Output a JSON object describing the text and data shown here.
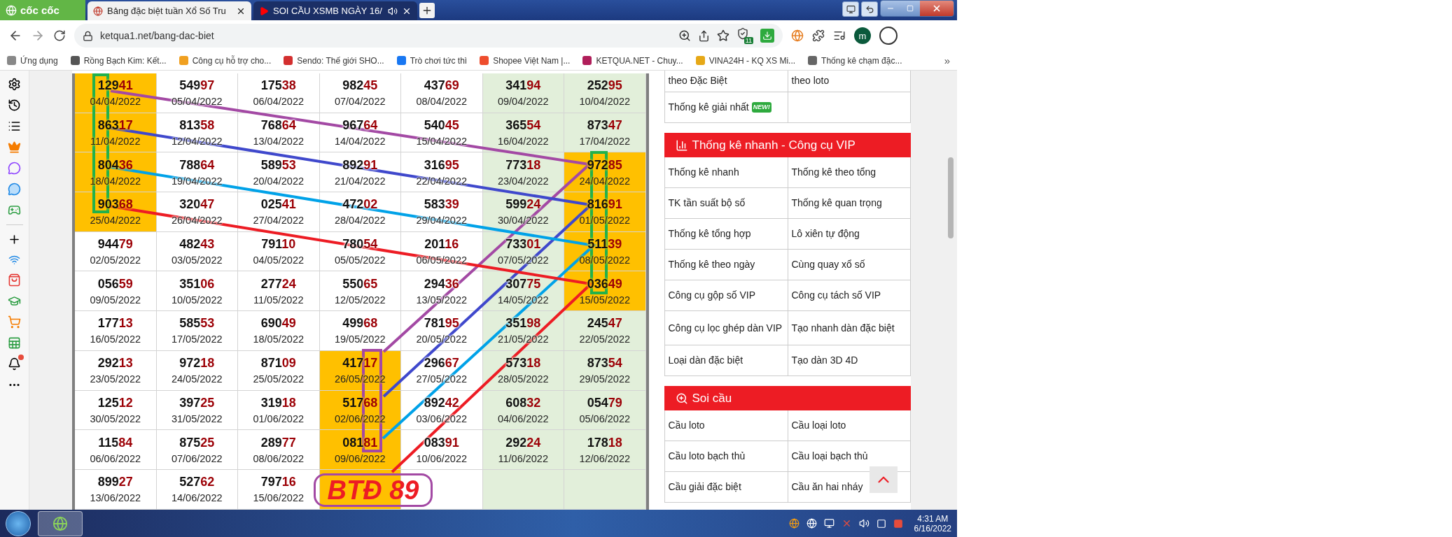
{
  "browser": {
    "logo": "cốc cốc",
    "tabs": [
      {
        "title": "Bảng đặc biệt tuần Xổ Số Tru",
        "selected": true,
        "kind": "site"
      },
      {
        "title": "SOI CẦU XSMB NGÀY 16/",
        "selected": false,
        "kind": "video"
      }
    ],
    "address": "ketqua1.net/bang-dac-biet",
    "extension_badge": "11",
    "profile_initial": "m",
    "bookmarks": [
      {
        "label": "Ứng dụng"
      },
      {
        "label": "Rồng Bạch Kim: Kết..."
      },
      {
        "label": "Công cụ hỗ trợ cho..."
      },
      {
        "label": "Sendo: Thế giới SHO..."
      },
      {
        "label": "Trò chơi tức thì"
      },
      {
        "label": "Shopee Việt Nam |..."
      },
      {
        "label": "KETQUA.NET - Chuy..."
      },
      {
        "label": "VINA24H - KQ XS Mi..."
      },
      {
        "label": "Thống kê chạm đặc..."
      }
    ],
    "more": "»"
  },
  "table": {
    "columns": [
      {
        "shaded": false
      },
      {
        "shaded": false
      },
      {
        "shaded": false
      },
      {
        "shaded": false
      },
      {
        "shaded": false
      },
      {
        "shaded": true
      },
      {
        "shaded": true
      }
    ],
    "rows": [
      [
        {
          "number": "12941",
          "date": "04/04/2022",
          "highlighted": true
        },
        {
          "number": "54997",
          "date": "05/04/2022",
          "highlighted": false
        },
        {
          "number": "17538",
          "date": "06/04/2022",
          "highlighted": false
        },
        {
          "number": "98245",
          "date": "07/04/2022",
          "highlighted": false
        },
        {
          "number": "43769",
          "date": "08/04/2022",
          "highlighted": false
        },
        {
          "number": "34194",
          "date": "09/04/2022",
          "highlighted": false
        },
        {
          "number": "25295",
          "date": "10/04/2022",
          "highlighted": false
        }
      ],
      [
        {
          "number": "86317",
          "date": "11/04/2022",
          "highlighted": true
        },
        {
          "number": "81358",
          "date": "12/04/2022",
          "highlighted": false
        },
        {
          "number": "76864",
          "date": "13/04/2022",
          "highlighted": false
        },
        {
          "number": "96764",
          "date": "14/04/2022",
          "highlighted": false
        },
        {
          "number": "54045",
          "date": "15/04/2022",
          "highlighted": false
        },
        {
          "number": "36554",
          "date": "16/04/2022",
          "highlighted": false
        },
        {
          "number": "87347",
          "date": "17/04/2022",
          "highlighted": false
        }
      ],
      [
        {
          "number": "80436",
          "date": "18/04/2022",
          "highlighted": true
        },
        {
          "number": "78864",
          "date": "19/04/2022",
          "highlighted": false
        },
        {
          "number": "58953",
          "date": "20/04/2022",
          "highlighted": false
        },
        {
          "number": "89291",
          "date": "21/04/2022",
          "highlighted": false
        },
        {
          "number": "31695",
          "date": "22/04/2022",
          "highlighted": false
        },
        {
          "number": "77318",
          "date": "23/04/2022",
          "highlighted": false
        },
        {
          "number": "97285",
          "date": "24/04/2022",
          "highlighted": true
        }
      ],
      [
        {
          "number": "90368",
          "date": "25/04/2022",
          "highlighted": true
        },
        {
          "number": "32047",
          "date": "26/04/2022",
          "highlighted": false
        },
        {
          "number": "02541",
          "date": "27/04/2022",
          "highlighted": false
        },
        {
          "number": "47202",
          "date": "28/04/2022",
          "highlighted": false
        },
        {
          "number": "58339",
          "date": "29/04/2022",
          "highlighted": false
        },
        {
          "number": "59924",
          "date": "30/04/2022",
          "highlighted": false
        },
        {
          "number": "81691",
          "date": "01/05/2022",
          "highlighted": true
        }
      ],
      [
        {
          "number": "94479",
          "date": "02/05/2022",
          "highlighted": false
        },
        {
          "number": "48243",
          "date": "03/05/2022",
          "highlighted": false
        },
        {
          "number": "79110",
          "date": "04/05/2022",
          "highlighted": false
        },
        {
          "number": "78054",
          "date": "05/05/2022",
          "highlighted": false
        },
        {
          "number": "20116",
          "date": "06/05/2022",
          "highlighted": false
        },
        {
          "number": "73301",
          "date": "07/05/2022",
          "highlighted": false
        },
        {
          "number": "51139",
          "date": "08/05/2022",
          "highlighted": true
        }
      ],
      [
        {
          "number": "05659",
          "date": "09/05/2022",
          "highlighted": false
        },
        {
          "number": "35106",
          "date": "10/05/2022",
          "highlighted": false
        },
        {
          "number": "27724",
          "date": "11/05/2022",
          "highlighted": false
        },
        {
          "number": "55065",
          "date": "12/05/2022",
          "highlighted": false
        },
        {
          "number": "29436",
          "date": "13/05/2022",
          "highlighted": false
        },
        {
          "number": "30775",
          "date": "14/05/2022",
          "highlighted": false
        },
        {
          "number": "03649",
          "date": "15/05/2022",
          "highlighted": true
        }
      ],
      [
        {
          "number": "17713",
          "date": "16/05/2022",
          "highlighted": false
        },
        {
          "number": "58553",
          "date": "17/05/2022",
          "highlighted": false
        },
        {
          "number": "69049",
          "date": "18/05/2022",
          "highlighted": false
        },
        {
          "number": "49968",
          "date": "19/05/2022",
          "highlighted": false
        },
        {
          "number": "78195",
          "date": "20/05/2022",
          "highlighted": false
        },
        {
          "number": "35198",
          "date": "21/05/2022",
          "highlighted": false
        },
        {
          "number": "24547",
          "date": "22/05/2022",
          "highlighted": false
        }
      ],
      [
        {
          "number": "29213",
          "date": "23/05/2022",
          "highlighted": false
        },
        {
          "number": "97218",
          "date": "24/05/2022",
          "highlighted": false
        },
        {
          "number": "87109",
          "date": "25/05/2022",
          "highlighted": false
        },
        {
          "number": "41717",
          "date": "26/05/2022",
          "highlighted": true
        },
        {
          "number": "29667",
          "date": "27/05/2022",
          "highlighted": false
        },
        {
          "number": "57318",
          "date": "28/05/2022",
          "highlighted": false
        },
        {
          "number": "87354",
          "date": "29/05/2022",
          "highlighted": false
        }
      ],
      [
        {
          "number": "12512",
          "date": "30/05/2022",
          "highlighted": false
        },
        {
          "number": "39725",
          "date": "31/05/2022",
          "highlighted": false
        },
        {
          "number": "31918",
          "date": "01/06/2022",
          "highlighted": false
        },
        {
          "number": "51768",
          "date": "02/06/2022",
          "highlighted": true
        },
        {
          "number": "89242",
          "date": "03/06/2022",
          "highlighted": false
        },
        {
          "number": "60832",
          "date": "04/06/2022",
          "highlighted": false
        },
        {
          "number": "05479",
          "date": "05/06/2022",
          "highlighted": false
        }
      ],
      [
        {
          "number": "11584",
          "date": "06/06/2022",
          "highlighted": false
        },
        {
          "number": "87525",
          "date": "07/06/2022",
          "highlighted": false
        },
        {
          "number": "28977",
          "date": "08/06/2022",
          "highlighted": false
        },
        {
          "number": "08181",
          "date": "09/06/2022",
          "highlighted": true
        },
        {
          "number": "08391",
          "date": "10/06/2022",
          "highlighted": false
        },
        {
          "number": "29224",
          "date": "11/06/2022",
          "highlighted": false
        },
        {
          "number": "17818",
          "date": "12/06/2022",
          "highlighted": false
        }
      ],
      [
        {
          "number": "89927",
          "date": "13/06/2022",
          "highlighted": false
        },
        {
          "number": "52762",
          "date": "14/06/2022",
          "highlighted": false
        },
        {
          "number": "79716",
          "date": "15/06/2022",
          "highlighted": false
        },
        {
          "highlighted": true
        },
        {
          "highlighted": false
        },
        {
          "highlighted": false
        },
        {
          "highlighted": false
        }
      ]
    ]
  },
  "annotation": {
    "label": "BTĐ 89",
    "frames": [
      {
        "color": "#22b14c"
      },
      {
        "color": "#22b14c"
      },
      {
        "color": "#a349a4"
      }
    ],
    "lines": [
      {
        "color": "#a349a4"
      },
      {
        "color": "#3f48cc"
      },
      {
        "color": "#00a2e8"
      },
      {
        "color": "#ed1c24"
      }
    ]
  },
  "sidebar": {
    "top_rows": [
      {
        "cells": [
          {
            "text": "theo Đặc Biệt"
          },
          {
            "text": "theo loto"
          }
        ]
      },
      {
        "cells": [
          {
            "text": "Thống kê giải nhất",
            "badge": "NEW!"
          }
        ]
      }
    ],
    "sections": [
      {
        "title": "Thống kê nhanh - Công cụ VIP",
        "kind": "chart",
        "rows": [
          [
            "Thống kê nhanh",
            "Thống kê theo tổng"
          ],
          [
            "TK tần suất bộ số",
            "Thống kê quan trọng"
          ],
          [
            "Thống kê tổng hợp",
            "Lô xiên tự động"
          ],
          [
            "Thống kê theo ngày",
            "Cùng quay xổ số"
          ],
          [
            "Công cụ gộp số VIP",
            "Công cụ tách số VIP"
          ],
          [
            "Công cụ lọc ghép dàn VIP",
            "Tạo nhanh dàn đặc biệt"
          ],
          [
            "Loại dàn đặc biệt",
            "Tạo dàn 3D 4D"
          ]
        ]
      },
      {
        "title": "Soi cầu",
        "kind": "search",
        "rows": [
          [
            "Cầu loto",
            "Cầu loại loto"
          ],
          [
            "Cầu loto bạch thủ",
            "Cầu loại bạch thủ"
          ],
          [
            "Cầu giải đặc biệt",
            "Cầu ăn hai nháy"
          ]
        ]
      }
    ]
  },
  "taskbar": {
    "time": "4:31 AM",
    "date": "6/16/2022"
  }
}
